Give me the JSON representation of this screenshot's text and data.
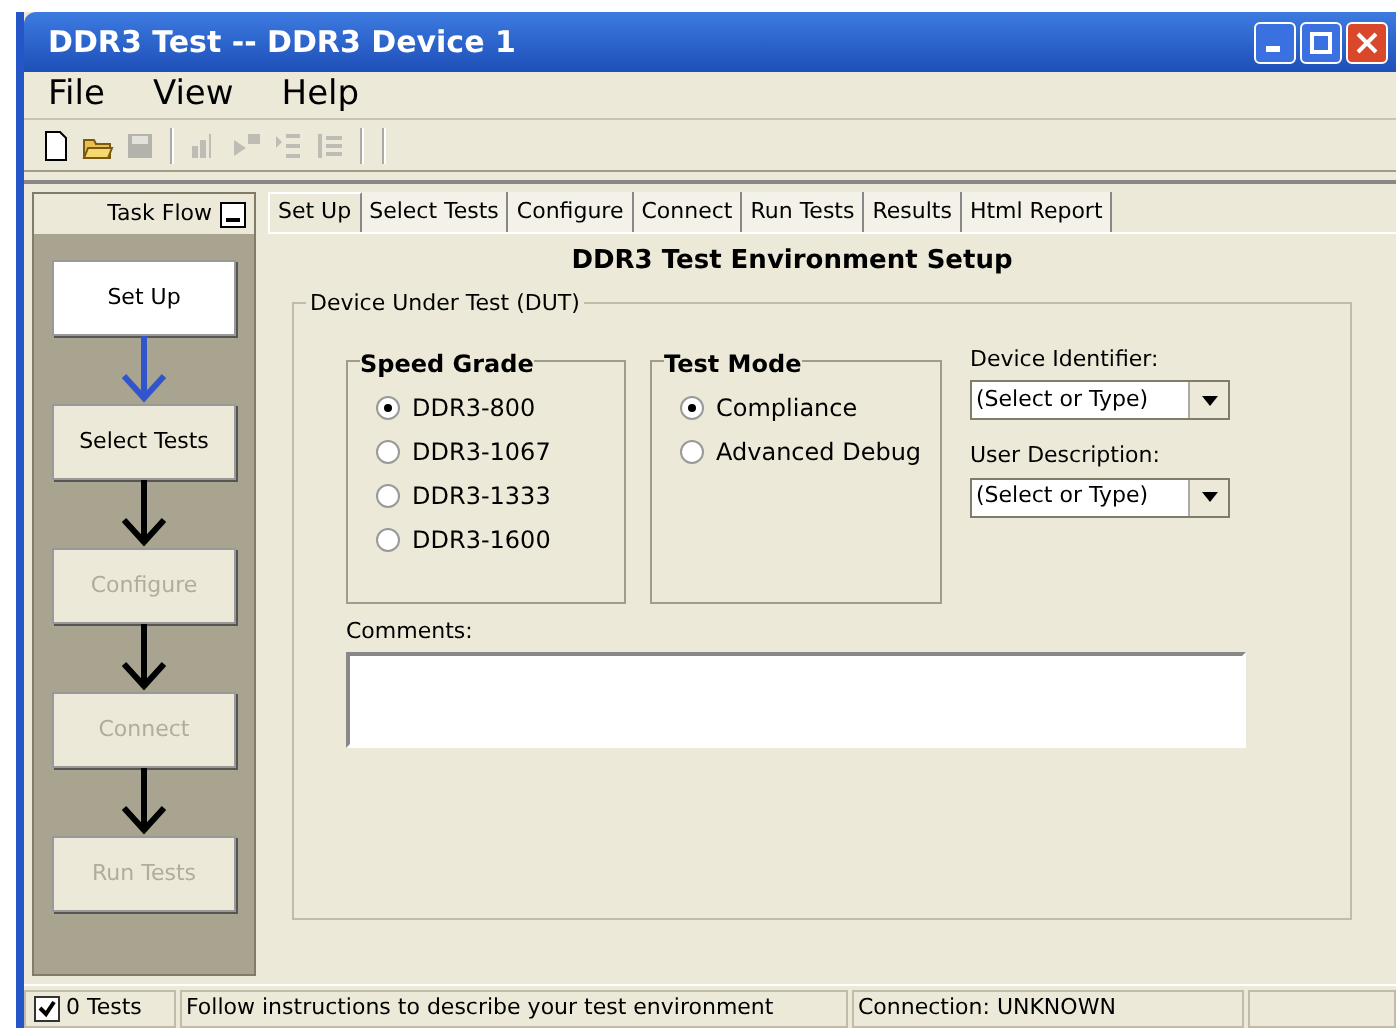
{
  "window": {
    "title": "DDR3 Test -- DDR3 Device 1"
  },
  "menu": [
    "File",
    "View",
    "Help"
  ],
  "toolbar": [
    {
      "kind": "new",
      "disabled": false
    },
    {
      "kind": "open",
      "disabled": false
    },
    {
      "kind": "save",
      "disabled": true
    },
    {
      "kind": "separator"
    },
    {
      "kind": "chart",
      "disabled": true
    },
    {
      "kind": "run",
      "disabled": true
    },
    {
      "kind": "list",
      "disabled": true
    },
    {
      "kind": "outline",
      "disabled": true
    },
    {
      "kind": "separator"
    },
    {
      "kind": "separator"
    }
  ],
  "task_flow": {
    "title": "Task Flow",
    "steps": [
      {
        "label": "Set Up",
        "selected": true,
        "disabled": false
      },
      {
        "label": "Select Tests",
        "selected": false,
        "disabled": false
      },
      {
        "label": "Configure",
        "selected": false,
        "disabled": true
      },
      {
        "label": "Connect",
        "selected": false,
        "disabled": true
      },
      {
        "label": "Run Tests",
        "selected": false,
        "disabled": true
      }
    ]
  },
  "tabs": [
    {
      "label": "Set Up",
      "selected": true
    },
    {
      "label": "Select Tests",
      "selected": false
    },
    {
      "label": "Configure",
      "selected": false
    },
    {
      "label": "Connect",
      "selected": false
    },
    {
      "label": "Run Tests",
      "selected": false
    },
    {
      "label": "Results",
      "selected": false
    },
    {
      "label": "Html Report",
      "selected": false
    }
  ],
  "heading": "DDR3 Test Environment Setup",
  "dut": {
    "title": "Device Under Test (DUT)",
    "speed_grade": {
      "title": "Speed Grade",
      "options": [
        {
          "label": "DDR3-800",
          "selected": true
        },
        {
          "label": "DDR3-1067",
          "selected": false
        },
        {
          "label": "DDR3-1333",
          "selected": false
        },
        {
          "label": "DDR3-1600",
          "selected": false
        }
      ]
    },
    "test_mode": {
      "title": "Test Mode",
      "options": [
        {
          "label": "Compliance",
          "selected": true
        },
        {
          "label": "Advanced Debug",
          "selected": false
        }
      ]
    },
    "fields": [
      {
        "label": "Device Identifier:",
        "value": "(Select or Type)"
      },
      {
        "label": "User Description:",
        "value": "(Select or Type)"
      }
    ],
    "comments": {
      "label": "Comments:"
    }
  },
  "status_bar": {
    "checked": true,
    "tests": "0 Tests",
    "message": "Follow instructions to describe your test environment",
    "connection": "Connection: UNKNOWN"
  }
}
